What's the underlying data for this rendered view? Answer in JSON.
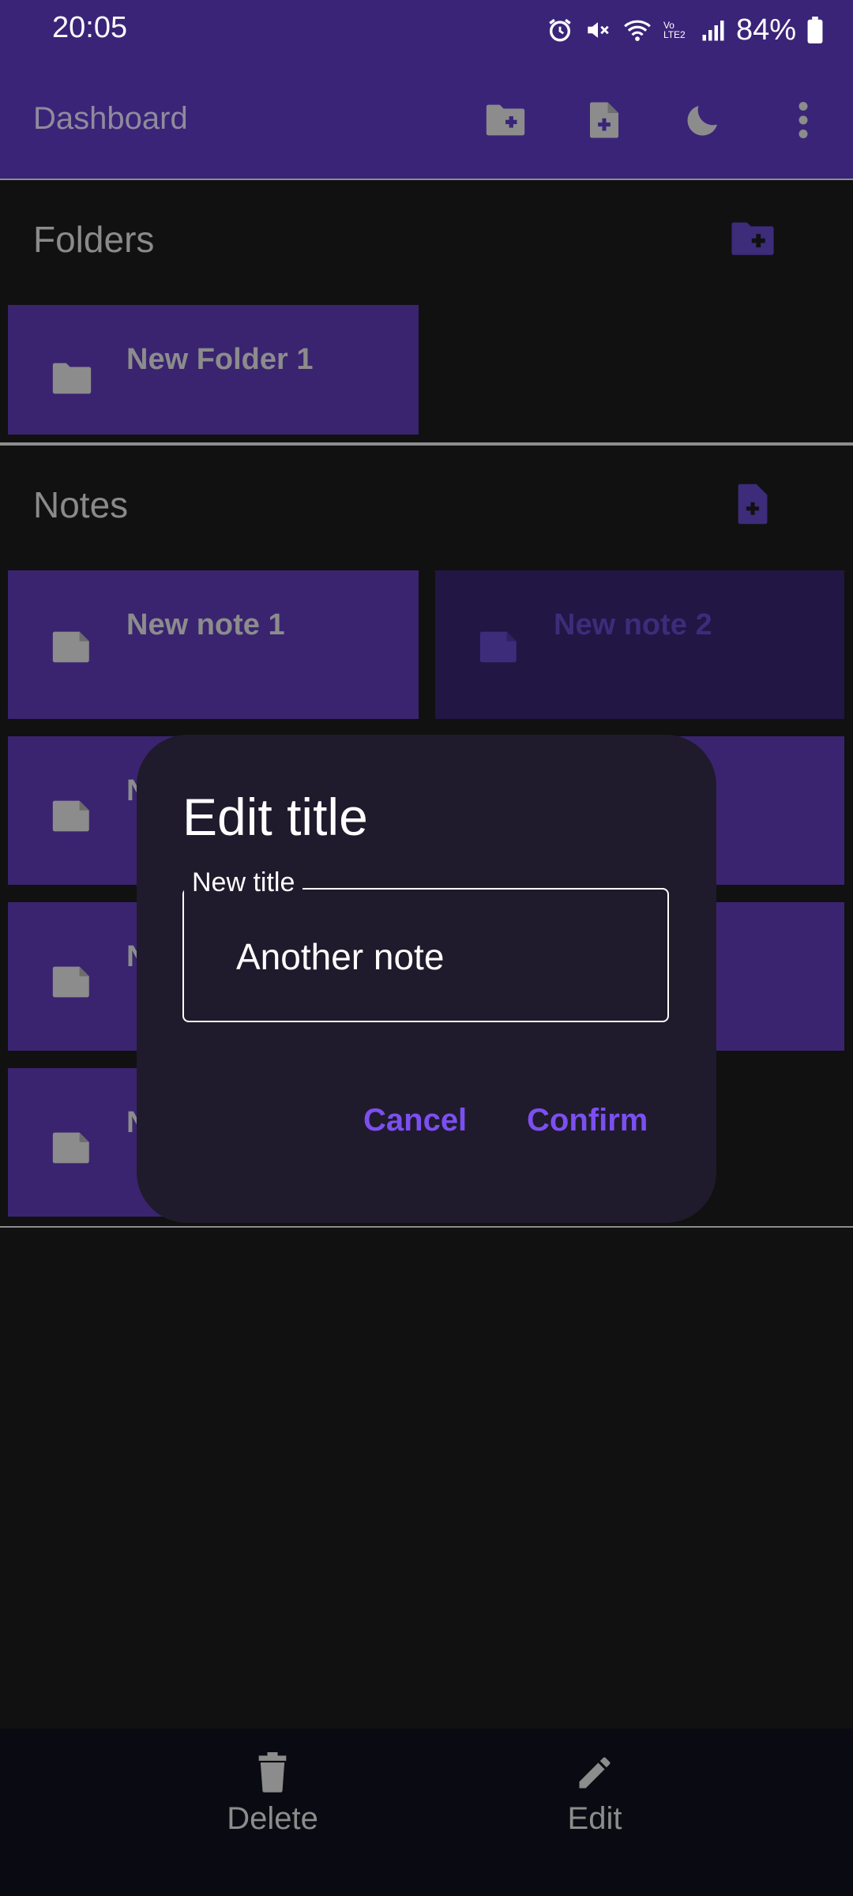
{
  "status_bar": {
    "time": "20:05",
    "network_badge": "Vo LTE2",
    "battery": "84%"
  },
  "app_bar": {
    "title": "Dashboard",
    "actions": [
      "new-folder-icon",
      "new-note-icon",
      "dark-mode-moon-icon",
      "more-vert-icon"
    ]
  },
  "folders": {
    "title": "Folders",
    "items": [
      {
        "label": "New Folder 1"
      }
    ]
  },
  "notes": {
    "title": "Notes",
    "items": [
      {
        "label": "New note 1"
      },
      {
        "label": "New note 2",
        "selected": true
      },
      {
        "label": "N"
      },
      {
        "label": "N"
      },
      {
        "label": "N"
      }
    ]
  },
  "dialog": {
    "title": "Edit title",
    "field_label": "New title",
    "field_value": "Another note",
    "cancel": "Cancel",
    "confirm": "Confirm"
  },
  "bottom_bar": {
    "delete": "Delete",
    "edit": "Edit"
  },
  "colors": {
    "app_bar": "#3a2478",
    "tile": "#3a2470",
    "tile_selected": "#211644",
    "dialog_bg": "#1f1b2c",
    "accent": "#7c4ff0",
    "background": "#111111"
  }
}
